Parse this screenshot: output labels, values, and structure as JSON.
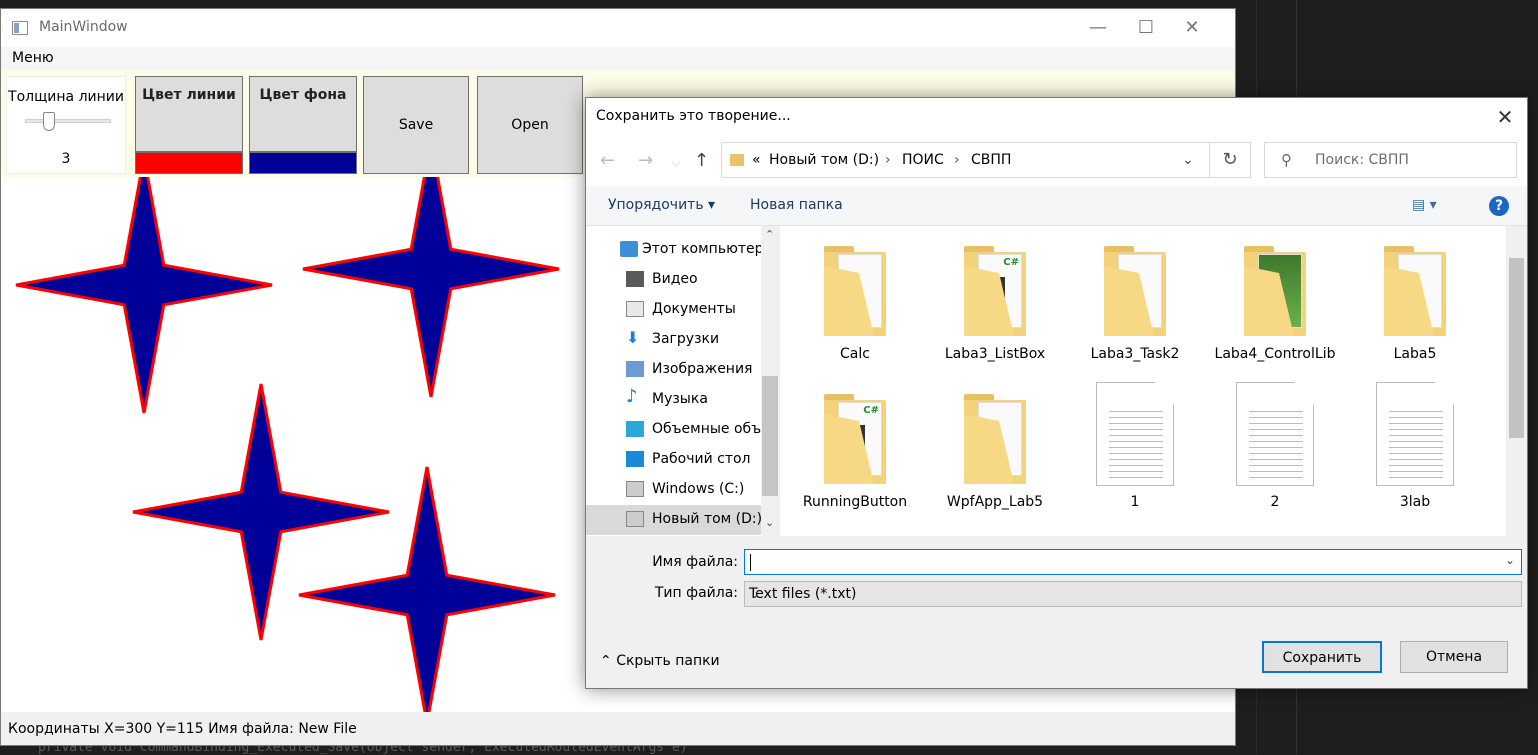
{
  "main_window": {
    "title": "MainWindow",
    "menu_label": "Меню",
    "thickness_label": "Толщина линии",
    "thickness_value": "3",
    "line_color_label": "Цвет линии",
    "line_color": "#ff0000",
    "bg_color_label": "Цвет фона",
    "bg_color": "#000099",
    "save_label": "Save",
    "open_label": "Open",
    "status_text": "Координаты X=300 Y=115  Имя файла: New File",
    "stars": [
      {
        "id": "star-1"
      },
      {
        "id": "star-2"
      },
      {
        "id": "star-3"
      },
      {
        "id": "star-4"
      }
    ]
  },
  "background_code": "private void CommandBinding_Executed_Save(object sender, ExecutedRoutedEventArgs e)",
  "dialog": {
    "title": "Сохранить это творение...",
    "breadcrumb": [
      "Новый том (D:)",
      "ПОИС",
      "СВПП"
    ],
    "breadcrumb_prefix": "«",
    "search_placeholder": "Поиск: СВПП",
    "organize_label": "Упорядочить",
    "new_folder_label": "Новая папка",
    "help_label": "?",
    "nav_items": [
      {
        "label": "Этот компьютер",
        "icon": "computer-icon"
      },
      {
        "label": "Видео",
        "icon": "video-icon"
      },
      {
        "label": "Документы",
        "icon": "documents-icon"
      },
      {
        "label": "Загрузки",
        "icon": "downloads-icon"
      },
      {
        "label": "Изображения",
        "icon": "pictures-icon"
      },
      {
        "label": "Музыка",
        "icon": "music-icon"
      },
      {
        "label": "Объемные объекты",
        "icon": "3d-objects-icon"
      },
      {
        "label": "Рабочий стол",
        "icon": "desktop-icon"
      },
      {
        "label": "Windows (C:)",
        "icon": "drive-c-icon"
      },
      {
        "label": "Новый том (D:)",
        "icon": "drive-d-icon"
      }
    ],
    "files": [
      {
        "name": "Calc",
        "kind": "folder"
      },
      {
        "name": "Laba3_ListBox",
        "kind": "folder-cs"
      },
      {
        "name": "Laba3_Task2",
        "kind": "folder"
      },
      {
        "name": "Laba4_ControlLib",
        "kind": "folder-img"
      },
      {
        "name": "Laba5",
        "kind": "folder"
      },
      {
        "name": "RunningButton",
        "kind": "folder-cs"
      },
      {
        "name": "WpfApp_Lab5",
        "kind": "folder"
      },
      {
        "name": "1",
        "kind": "text"
      },
      {
        "name": "2",
        "kind": "text"
      },
      {
        "name": "3lab",
        "kind": "text"
      }
    ],
    "filename_label": "Имя файла:",
    "filename_value": "",
    "filetype_label": "Тип файла:",
    "filetype_value": "Text files (*.txt)",
    "hide_folders_label": "Скрыть папки",
    "save_button": "Сохранить",
    "cancel_button": "Отмена"
  }
}
